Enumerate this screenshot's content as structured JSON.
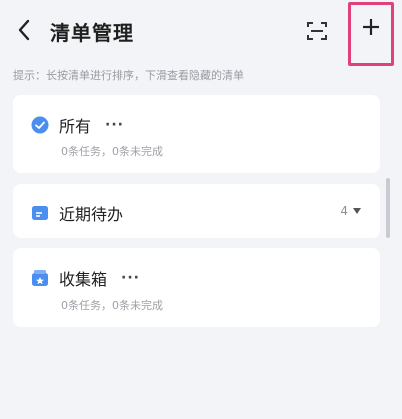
{
  "header": {
    "title": "清单管理",
    "back_icon": "chevron-left-icon",
    "scan_icon": "scan-icon",
    "add_icon": "plus-icon",
    "highlight_color": "#e0417a"
  },
  "hint": "提示：长按清单进行排序，下滑查看隐藏的清单",
  "lists": [
    {
      "name": "所有",
      "icon": "check-circle-icon",
      "icon_color": "#4a8ef0",
      "more": "···",
      "subtitle": "0条任务，0条未完成"
    },
    {
      "name": "近期待办",
      "icon": "inbox-tray-icon",
      "icon_color": "#4a8ef0",
      "count": "4"
    },
    {
      "name": "收集箱",
      "icon": "collection-box-icon",
      "icon_color": "#4a8ef0",
      "more": "···",
      "subtitle": "0条任务，0条未完成"
    }
  ]
}
